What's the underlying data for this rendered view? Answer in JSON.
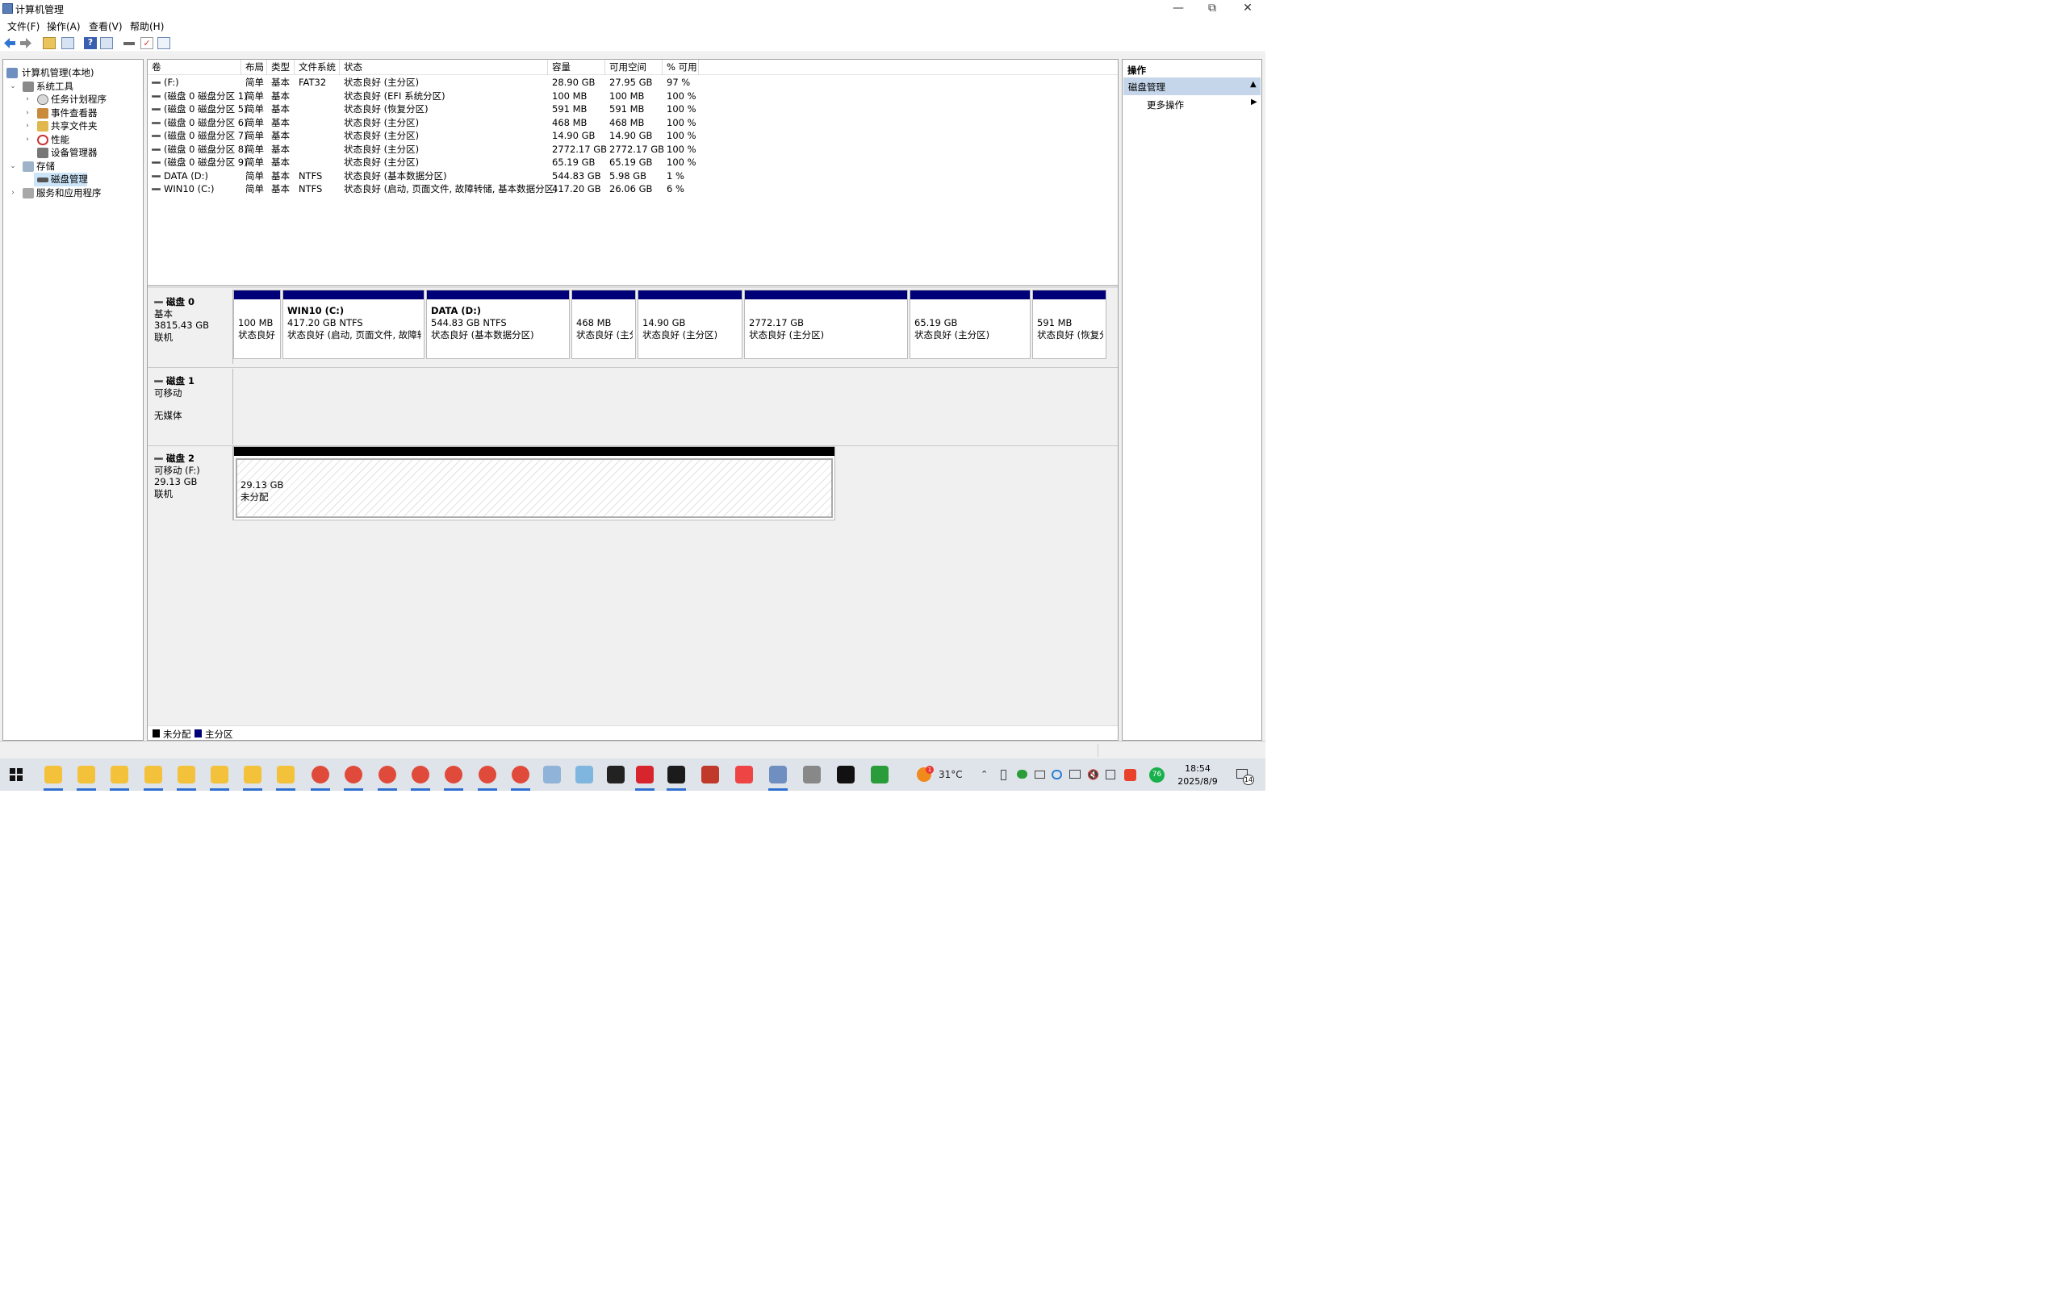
{
  "window": {
    "title": "计算机管理"
  },
  "menu": [
    "文件(F)",
    "操作(A)",
    "查看(V)",
    "帮助(H)"
  ],
  "tree": {
    "root": "计算机管理(本地)",
    "system_tools": "系统工具",
    "task_scheduler": "任务计划程序",
    "event_viewer": "事件查看器",
    "shared_folders": "共享文件夹",
    "performance": "性能",
    "device_manager": "设备管理器",
    "storage": "存储",
    "disk_management": "磁盘管理",
    "services": "服务和应用程序"
  },
  "table": {
    "headers": [
      "卷",
      "布局",
      "类型",
      "文件系统",
      "状态",
      "容量",
      "可用空间",
      "% 可用"
    ],
    "rows": [
      [
        "(F:)",
        "简单",
        "基本",
        "FAT32",
        "状态良好 (主分区)",
        "28.90 GB",
        "27.95 GB",
        "97 %"
      ],
      [
        "(磁盘 0 磁盘分区 1)",
        "简单",
        "基本",
        "",
        "状态良好 (EFI 系统分区)",
        "100 MB",
        "100 MB",
        "100 %"
      ],
      [
        "(磁盘 0 磁盘分区 5)",
        "简单",
        "基本",
        "",
        "状态良好 (恢复分区)",
        "591 MB",
        "591 MB",
        "100 %"
      ],
      [
        "(磁盘 0 磁盘分区 6)",
        "简单",
        "基本",
        "",
        "状态良好 (主分区)",
        "468 MB",
        "468 MB",
        "100 %"
      ],
      [
        "(磁盘 0 磁盘分区 7)",
        "简单",
        "基本",
        "",
        "状态良好 (主分区)",
        "14.90 GB",
        "14.90 GB",
        "100 %"
      ],
      [
        "(磁盘 0 磁盘分区 8)",
        "简单",
        "基本",
        "",
        "状态良好 (主分区)",
        "2772.17 GB",
        "2772.17 GB",
        "100 %"
      ],
      [
        "(磁盘 0 磁盘分区 9)",
        "简单",
        "基本",
        "",
        "状态良好 (主分区)",
        "65.19 GB",
        "65.19 GB",
        "100 %"
      ],
      [
        "DATA (D:)",
        "简单",
        "基本",
        "NTFS",
        "状态良好 (基本数据分区)",
        "544.83 GB",
        "5.98 GB",
        "1 %"
      ],
      [
        "WIN10 (C:)",
        "简单",
        "基本",
        "NTFS",
        "状态良好 (启动, 页面文件, 故障转储, 基本数据分区)",
        "417.20 GB",
        "26.06 GB",
        "6 %"
      ]
    ]
  },
  "disks": {
    "disk0": {
      "name": "磁盘 0",
      "type": "基本",
      "size": "3815.43 GB",
      "status": "联机",
      "partitions": [
        {
          "title": "",
          "size": "100 MB",
          "status": "状态良好 (EFI 系统分区)"
        },
        {
          "title": "WIN10  (C:)",
          "size": "417.20 GB NTFS",
          "status": "状态良好 (启动, 页面文件, 故障转储, 基本数据分区)"
        },
        {
          "title": "DATA  (D:)",
          "size": "544.83 GB NTFS",
          "status": "状态良好 (基本数据分区)"
        },
        {
          "title": "",
          "size": "468 MB",
          "status": "状态良好 (主分区)"
        },
        {
          "title": "",
          "size": "14.90 GB",
          "status": "状态良好 (主分区)"
        },
        {
          "title": "",
          "size": "2772.17 GB",
          "status": "状态良好 (主分区)"
        },
        {
          "title": "",
          "size": "65.19 GB",
          "status": "状态良好 (主分区)"
        },
        {
          "title": "",
          "size": "591 MB",
          "status": "状态良好 (恢复分区)"
        }
      ]
    },
    "disk1": {
      "name": "磁盘 1",
      "type": "可移动",
      "status": "无媒体"
    },
    "disk2": {
      "name": "磁盘 2",
      "type": "可移动 (F:)",
      "size": "29.13 GB",
      "status": "联机",
      "partition": {
        "size": "29.13 GB",
        "status": "未分配"
      }
    }
  },
  "legend": {
    "unallocated": "未分配",
    "primary": "主分区"
  },
  "actions": {
    "header": "操作",
    "section": "磁盘管理",
    "more": "更多操作"
  },
  "taskbar": {
    "temperature": "31°C",
    "time": "18:54",
    "date": "2025/8/9",
    "notifications": "14",
    "badge": "76",
    "weather_badge": "1"
  },
  "colors": {
    "primary_partition": "#000078",
    "unallocated": "#000000",
    "selection": "#cce4f7",
    "action_header": "#c5d6ea"
  }
}
